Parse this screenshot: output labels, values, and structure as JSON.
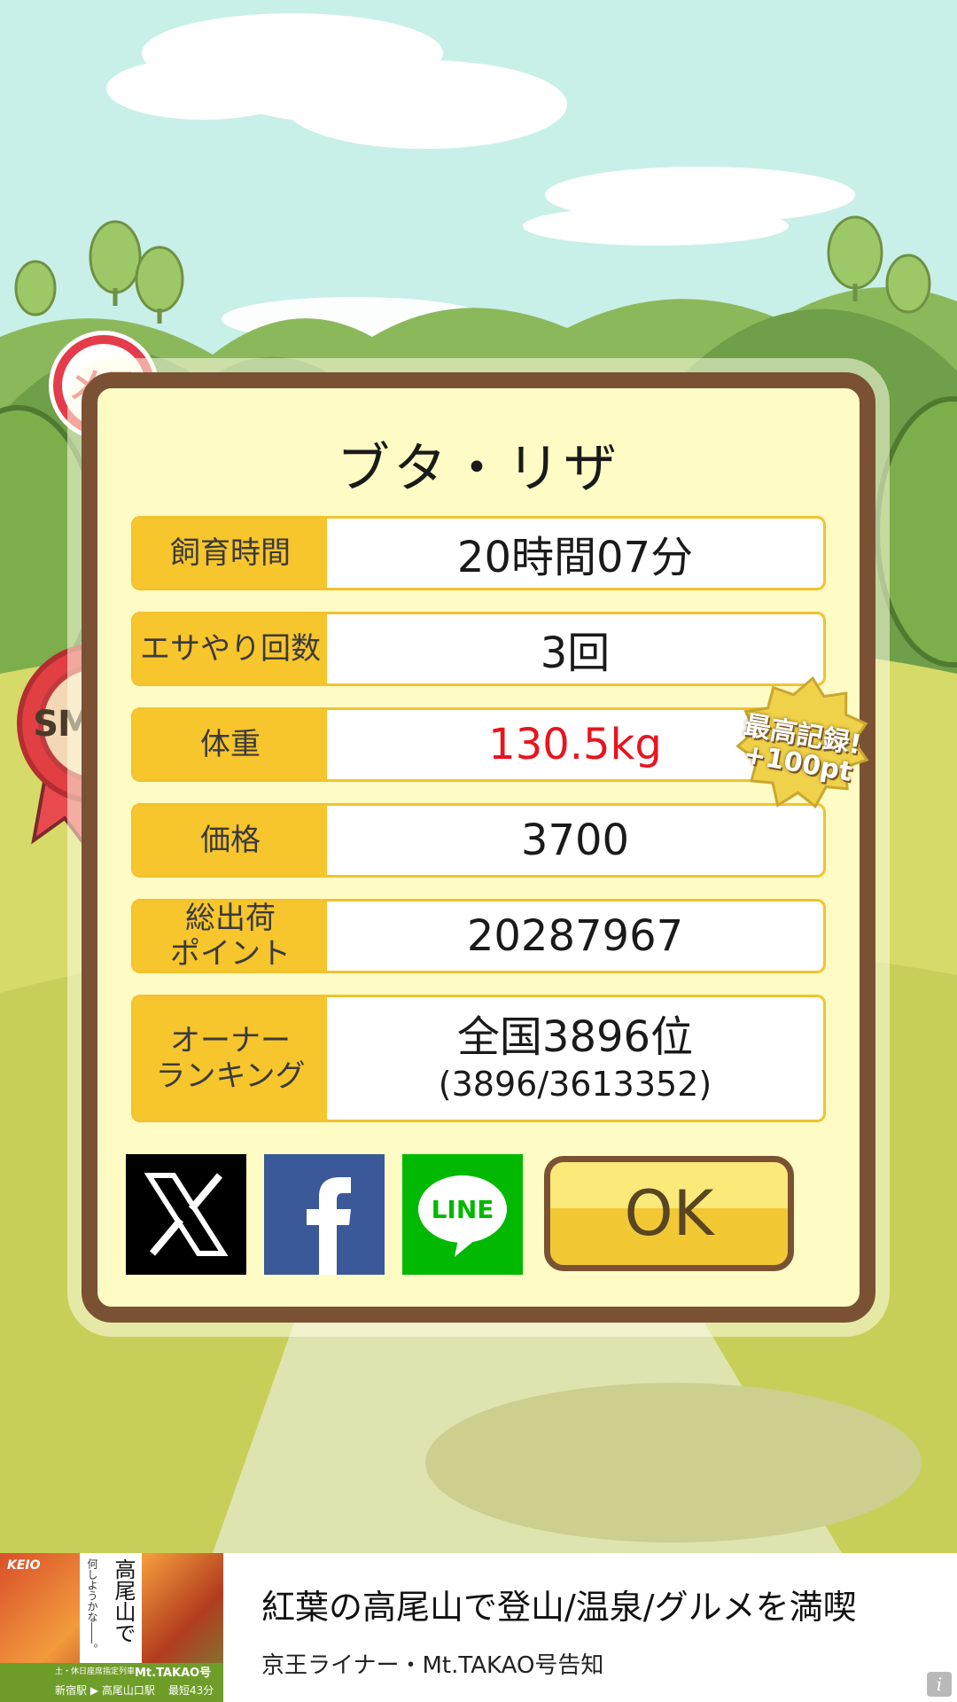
{
  "pig": {
    "name": "ブタ・リザ",
    "gender_badge": "メス",
    "size_badge": "SMALL",
    "record_badge": [
      "最高記録!",
      "+100pt"
    ]
  },
  "stats": [
    {
      "label": "飼育時間",
      "value": "20時間07分"
    },
    {
      "label": "エサやり回数",
      "value": "3回"
    },
    {
      "label": "体重",
      "value": "130.5kg",
      "color": "#e8141e"
    },
    {
      "label": "価格",
      "value": "3700"
    },
    {
      "label_lines": [
        "総出荷",
        "ポイント"
      ],
      "value": "20287967"
    },
    {
      "label_lines": [
        "オーナー",
        "ランキング"
      ],
      "value": "全国3896位",
      "value2": "(3896/3613352)"
    }
  ],
  "buttons": {
    "ok": "OK",
    "line": "LINE"
  },
  "ad": {
    "headline": "紅葉の高尾山で登山/温泉/グルメを満喫",
    "subtext": "京王ライナー・Mt.TAKAO号告知",
    "image_texts": {
      "brand": "KEIO",
      "title_vertical": "高尾山で",
      "tagline_vertical": "何しようかな――。",
      "service": "Mt.TAKAO号",
      "service_note": "土・休日座席指定列車",
      "route": "新宿駅 ▶ 高尾山口駅",
      "duration": "最短43分"
    }
  },
  "colors": {
    "sky": "#c8f0e8",
    "panel": "#fffbc4",
    "frame": "#7a5233",
    "label_bg": "#f7c52c",
    "weight_red": "#e8141e",
    "x_black": "#000000",
    "facebook_blue": "#3b5998",
    "line_green": "#00b900"
  }
}
